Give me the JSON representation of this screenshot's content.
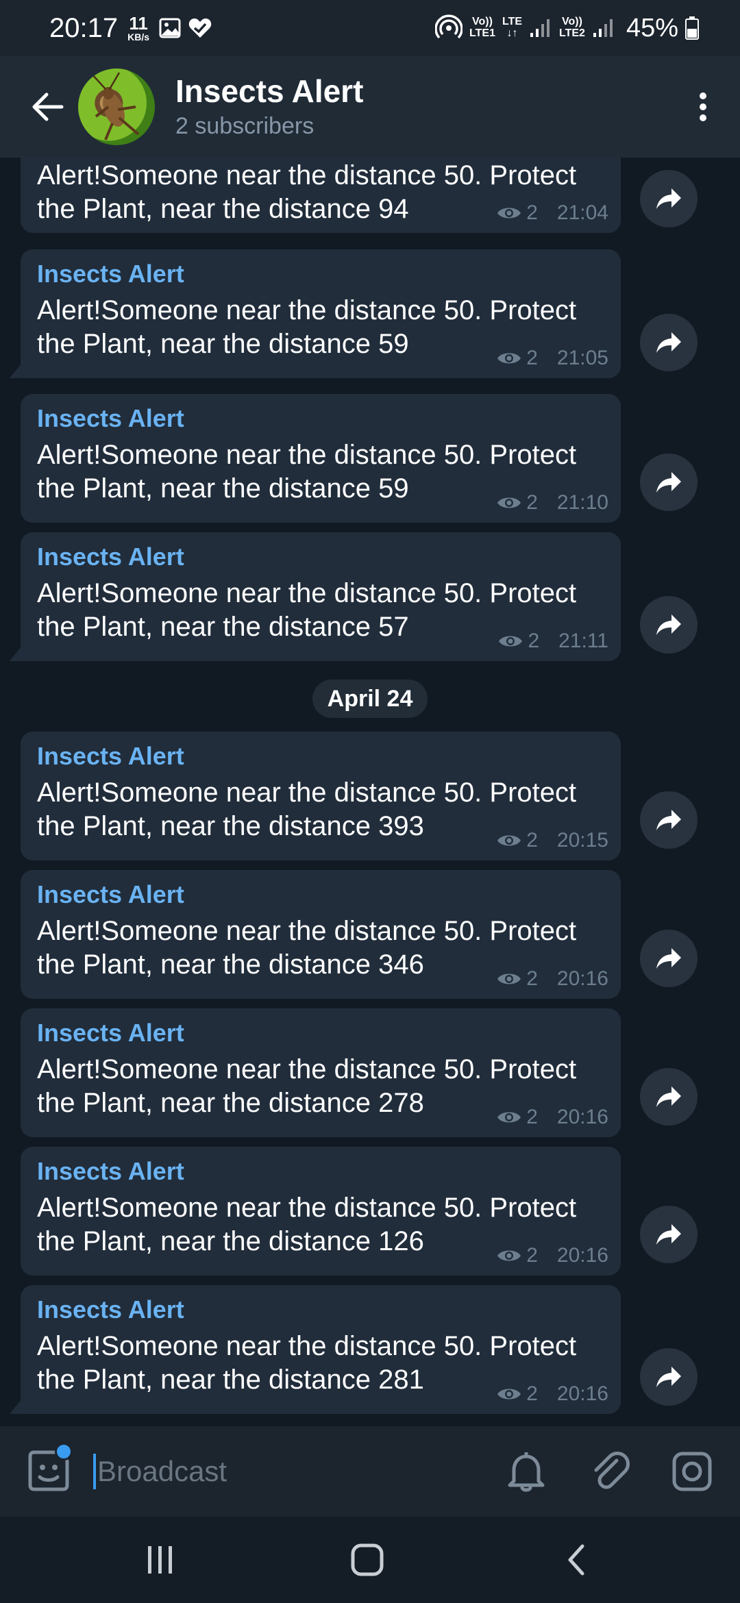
{
  "status_bar": {
    "time": "20:17",
    "speed_value": "11",
    "speed_unit": "KB/s",
    "net1_top": "Vo))",
    "net1_bottom": "LTE1",
    "net_mid_top": "LTE",
    "net_mid_bottom": "↓↑",
    "net2_top": "Vo))",
    "net2_bottom": "LTE2",
    "battery": "45%"
  },
  "header": {
    "title": "Insects Alert",
    "subtitle": "2 subscribers"
  },
  "messages_part1": [
    {
      "sender": "",
      "line1": "Alert!Someone near the distance 50. Protect",
      "line2": "the Plant, near the distance 94",
      "views": "2",
      "time": "21:04"
    },
    {
      "sender": "Insects Alert",
      "line1": "Alert!Someone near the distance 50. Protect",
      "line2": "the Plant, near the distance 59",
      "views": "2",
      "time": "21:05"
    },
    {
      "sender": "Insects Alert",
      "line1": "Alert!Someone near the distance 50. Protect",
      "line2": "the Plant, near the distance 59",
      "views": "2",
      "time": "21:10"
    },
    {
      "sender": "Insects Alert",
      "line1": "Alert!Someone near the distance 50. Protect",
      "line2": "the Plant, near the distance 57",
      "views": "2",
      "time": "21:11"
    }
  ],
  "date_separator": "April 24",
  "messages_part2": [
    {
      "sender": "Insects Alert",
      "line1": "Alert!Someone near the distance 50. Protect",
      "line2": "the Plant, near the distance 393",
      "views": "2",
      "time": "20:15"
    },
    {
      "sender": "Insects Alert",
      "line1": "Alert!Someone near the distance 50. Protect",
      "line2": "the Plant, near the distance 346",
      "views": "2",
      "time": "20:16"
    },
    {
      "sender": "Insects Alert",
      "line1": "Alert!Someone near the distance 50. Protect",
      "line2": "the Plant, near the distance 278",
      "views": "2",
      "time": "20:16"
    },
    {
      "sender": "Insects Alert",
      "line1": "Alert!Someone near the distance 50. Protect",
      "line2": "the Plant, near the distance 126",
      "views": "2",
      "time": "20:16"
    },
    {
      "sender": "Insects Alert",
      "line1": "Alert!Someone near the distance 50. Protect",
      "line2": "the Plant, near the distance 281",
      "views": "2",
      "time": "20:16"
    }
  ],
  "composer": {
    "placeholder": "Broadcast"
  },
  "colors": {
    "accent": "#6ab3f3",
    "bubble": "#212d3b",
    "background": "#111a23"
  },
  "icons": [
    "back-arrow-icon",
    "more-vert-icon",
    "share-icon",
    "eye-icon",
    "sticker-icon",
    "bell-icon",
    "paperclip-icon",
    "camera-icon"
  ]
}
